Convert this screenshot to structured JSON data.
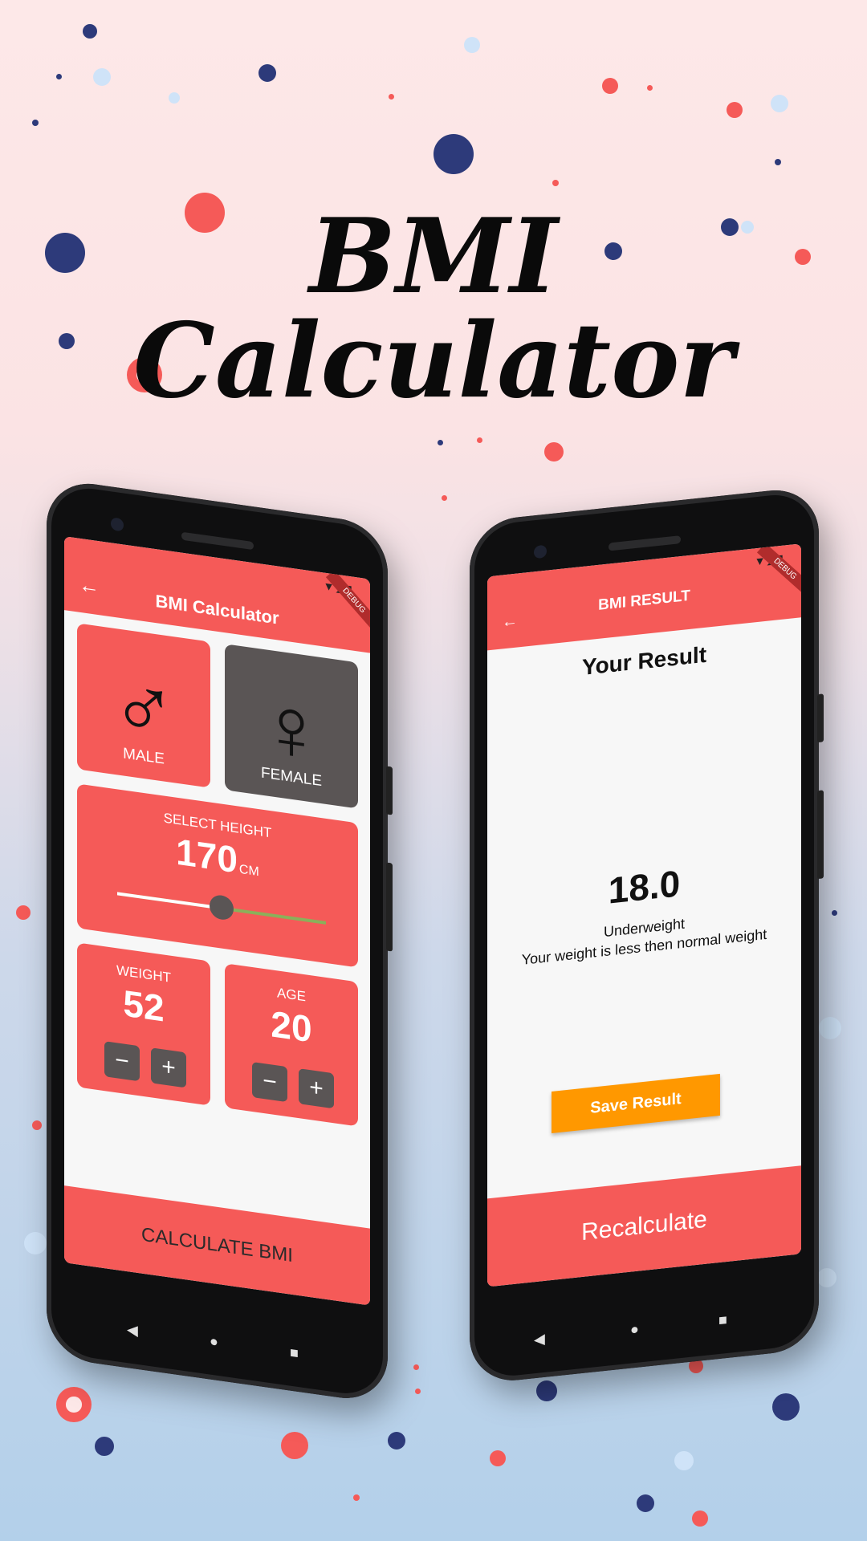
{
  "hero": {
    "title_line1": "BMI",
    "title_line2": "Calculator"
  },
  "colors": {
    "accent": "#f55a58",
    "dark_card": "#5a5555",
    "save_button": "#ff9800",
    "navy_dot": "#2d3a7a"
  },
  "calculator_screen": {
    "app_title": "BMI Calculator",
    "debug_banner": "DEBUG",
    "back_icon": "arrow-left-icon",
    "gender": {
      "male": {
        "label": "MALE",
        "icon": "male-symbol-icon",
        "symbol": "♂"
      },
      "female": {
        "label": "FEMALE",
        "icon": "female-symbol-icon",
        "symbol": "♀"
      },
      "selected": "female"
    },
    "height": {
      "label": "SELECT HEIGHT",
      "value": "170",
      "unit": "CM",
      "slider_fraction": 0.5
    },
    "weight": {
      "label": "WEIGHT",
      "value": "52",
      "minus": "−",
      "plus": "+"
    },
    "age": {
      "label": "AGE",
      "value": "20",
      "minus": "−",
      "plus": "+"
    },
    "calculate_button": "CALCULATE BMI",
    "nav": {
      "back": "◀",
      "home": "●",
      "recents": "■"
    }
  },
  "result_screen": {
    "app_title": "BMI RESULT",
    "debug_banner": "DEBUG",
    "heading": "Your Result",
    "bmi_value": "18.0",
    "category": "Underweight",
    "message": "Your weight is less then normal weight",
    "save_button": "Save Result",
    "recalculate_button": "Recalculate",
    "nav": {
      "back": "◀",
      "home": "●",
      "recents": "■"
    }
  }
}
